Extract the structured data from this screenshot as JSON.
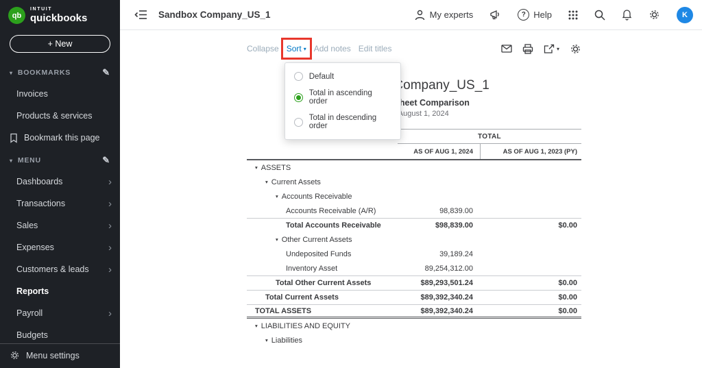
{
  "brand": {
    "logo": "qb",
    "intuit": "INTUIT",
    "name": "quickbooks"
  },
  "colors": {
    "brand_green": "#2ca01c",
    "link_blue": "#0077c5",
    "highlight_red": "#e8372c",
    "avatar_blue": "#1e88e5",
    "sidebar_bg": "#1e2126"
  },
  "icons": {
    "pencil": "✎",
    "chevron_right": "›",
    "section_caret": "▾",
    "sort_caret": "▾",
    "row_arrow": "▾",
    "export_caret": "▾"
  },
  "sidebar": {
    "new_button": "+ New",
    "bookmarks": {
      "title": "BOOKMARKS",
      "items": [
        "Invoices",
        "Products & services"
      ],
      "bookmark_action": "Bookmark this page"
    },
    "menu": {
      "title": "MENU",
      "items": [
        {
          "label": "Dashboards",
          "chevron": true,
          "active": false
        },
        {
          "label": "Transactions",
          "chevron": true,
          "active": false
        },
        {
          "label": "Sales",
          "chevron": true,
          "active": false
        },
        {
          "label": "Expenses",
          "chevron": true,
          "active": false
        },
        {
          "label": "Customers & leads",
          "chevron": true,
          "active": false
        },
        {
          "label": "Reports",
          "chevron": false,
          "active": true
        },
        {
          "label": "Payroll",
          "chevron": true,
          "active": false
        },
        {
          "label": "Budgets",
          "chevron": false,
          "active": false
        }
      ]
    },
    "footer": "Menu settings"
  },
  "header": {
    "company_name": "Sandbox Company_US_1",
    "my_experts": "My experts",
    "help": "Help",
    "avatar_initial": "K"
  },
  "toolbar": {
    "collapse": "Collapse",
    "sort": "Sort",
    "add_notes": "Add notes",
    "edit_titles": "Edit titles"
  },
  "sort_menu": [
    {
      "label": "Default",
      "selected": false
    },
    {
      "label": "Total in ascending order",
      "selected": true
    },
    {
      "label": "Total in descending order",
      "selected": false
    }
  ],
  "report": {
    "company": "Sandbox Company_US_1",
    "title": "Balance Sheet Comparison",
    "as_of": "As of August 1, 2024",
    "total_header": "TOTAL",
    "col1": "AS OF AUG 1, 2024",
    "col2": "AS OF AUG 1, 2023 (PY)",
    "rows": [
      {
        "label": "ASSETS",
        "indent": 0,
        "arrow": true,
        "v1": "",
        "v2": ""
      },
      {
        "label": "Current Assets",
        "indent": 1,
        "arrow": true,
        "v1": "",
        "v2": ""
      },
      {
        "label": "Accounts Receivable",
        "indent": 2,
        "arrow": true,
        "v1": "",
        "v2": ""
      },
      {
        "label": "Accounts Receivable (A/R)",
        "indent": 3,
        "arrow": false,
        "v1": "98,839.00",
        "v2": ""
      },
      {
        "label": "Total Accounts Receivable",
        "indent": 3,
        "arrow": false,
        "bold": true,
        "topline": true,
        "v1": "$98,839.00",
        "v2": "$0.00"
      },
      {
        "label": "Other Current Assets",
        "indent": 2,
        "arrow": true,
        "v1": "",
        "v2": ""
      },
      {
        "label": "Undeposited Funds",
        "indent": 3,
        "arrow": false,
        "v1": "39,189.24",
        "v2": ""
      },
      {
        "label": "Inventory Asset",
        "indent": 3,
        "arrow": false,
        "v1": "89,254,312.00",
        "v2": ""
      },
      {
        "label": "Total Other Current Assets",
        "indent": 2,
        "arrow": false,
        "bold": true,
        "topline": true,
        "v1": "$89,293,501.24",
        "v2": "$0.00"
      },
      {
        "label": "Total Current Assets",
        "indent": 1,
        "arrow": false,
        "bold": true,
        "topline": true,
        "v1": "$89,392,340.24",
        "v2": "$0.00"
      },
      {
        "label": "TOTAL ASSETS",
        "indent": 0,
        "arrow": false,
        "bold": true,
        "topline": true,
        "dbl": true,
        "v1": "$89,392,340.24",
        "v2": "$0.00"
      },
      {
        "label": "LIABILITIES AND EQUITY",
        "indent": 0,
        "arrow": true,
        "v1": "",
        "v2": ""
      },
      {
        "label": "Liabilities",
        "indent": 1,
        "arrow": true,
        "v1": "",
        "v2": ""
      }
    ]
  }
}
